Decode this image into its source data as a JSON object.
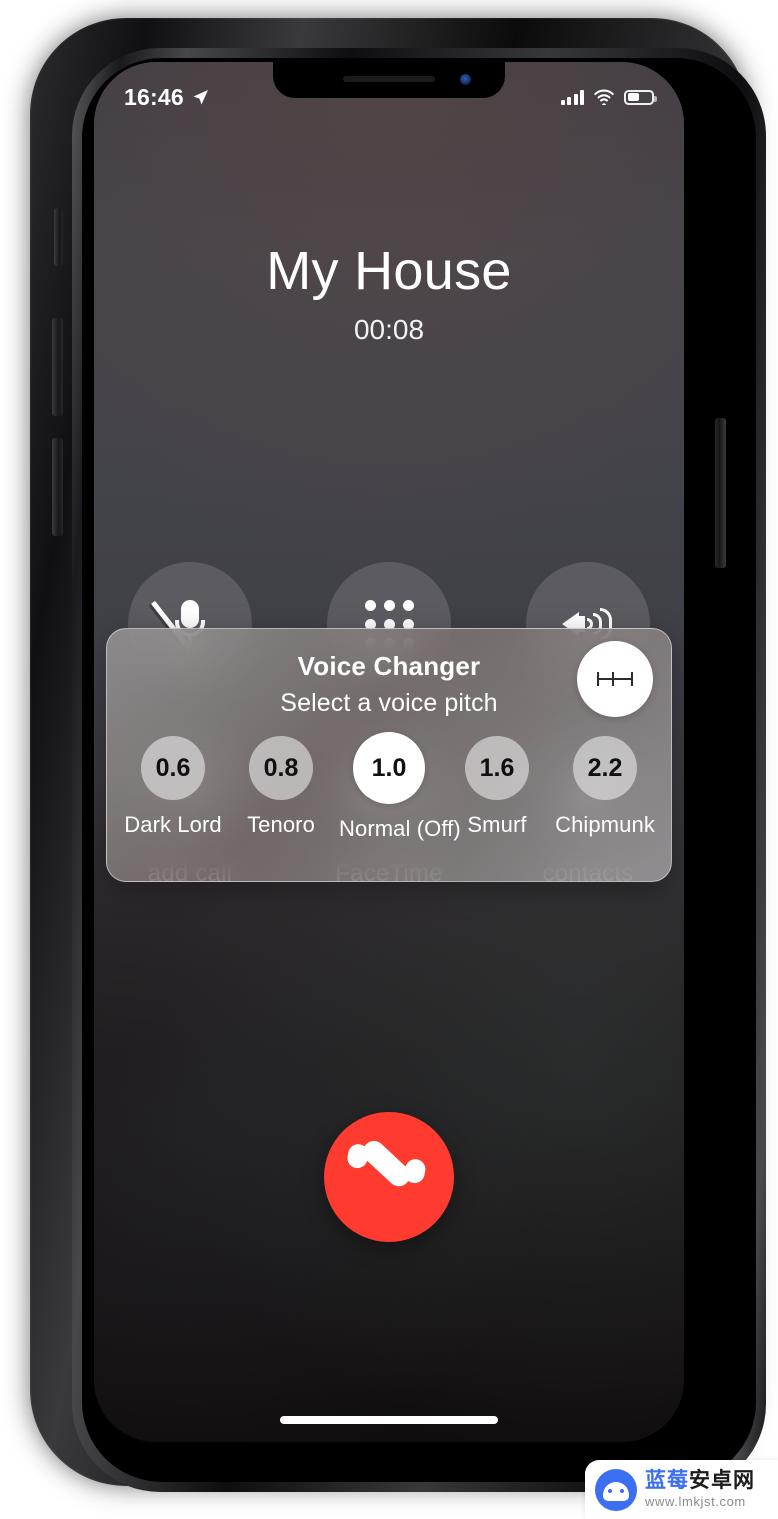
{
  "status_bar": {
    "time": "16:46",
    "location_icon": "location-arrow-icon",
    "signal_icon": "cellular-signal-icon",
    "wifi_icon": "wifi-icon",
    "battery_icon": "battery-icon",
    "battery_level_percent": 52
  },
  "call": {
    "callee_name": "My House",
    "duration": "00:08",
    "buttons": [
      {
        "label": "",
        "icon": "mute-microphone-icon",
        "name": "mute-button"
      },
      {
        "label": "",
        "icon": "keypad-icon",
        "name": "keypad-button"
      },
      {
        "label": "",
        "icon": "speaker-icon",
        "name": "speaker-button"
      },
      {
        "label": "add call",
        "icon": "add-call-icon",
        "name": "add-call-button"
      },
      {
        "label": "FaceTime",
        "icon": "facetime-icon",
        "name": "facetime-button"
      },
      {
        "label": "contacts",
        "icon": "contacts-icon",
        "name": "contacts-button"
      }
    ],
    "end_call_icon": "hangup-icon",
    "end_call_color": "#ff3b30"
  },
  "voice_changer": {
    "title": "Voice Changer",
    "subtitle": "Select a voice pitch",
    "action_icon": "pitch-slider-icon",
    "options": [
      {
        "value": "0.6",
        "label": "Dark Lord",
        "selected": false
      },
      {
        "value": "0.8",
        "label": "Tenoro",
        "selected": false
      },
      {
        "value": "1.0",
        "label": "Normal (Off)",
        "selected": true
      },
      {
        "value": "1.6",
        "label": "Smurf",
        "selected": false
      },
      {
        "value": "2.2",
        "label": "Chipmunk",
        "selected": false
      }
    ]
  },
  "watermark": {
    "brand_cn_blue": "蓝莓",
    "brand_cn_dark": "安卓网",
    "url": "www.lmkjst.com",
    "icon": "android-robot-icon",
    "brand_color": "#3b6ef0"
  }
}
